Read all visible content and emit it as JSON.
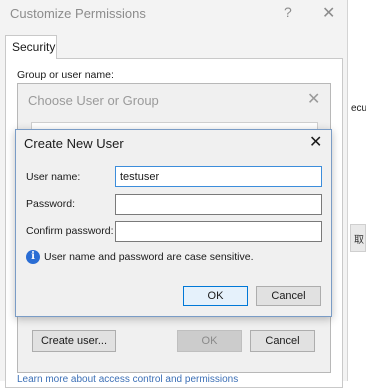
{
  "permissions_window": {
    "title": "Customize Permissions",
    "help_glyph": "?",
    "close_glyph": "✕",
    "tab_label": "Security",
    "group_label": "Group or user name:"
  },
  "behind_window": {
    "fragment_text": "ecu",
    "button_fragment": "取"
  },
  "choose_dialog": {
    "title": "Choose User or Group",
    "close_glyph": "✕",
    "create_user_label": "Create user...",
    "ok_label": "OK",
    "cancel_label": "Cancel",
    "bottom_link": "Learn more about access control and permissions"
  },
  "create_dialog": {
    "title": "Create New User",
    "close_glyph": "✕",
    "username_label": "User name:",
    "username_value": "testuser",
    "password_label": "Password:",
    "password_value": "",
    "confirm_label": "Confirm password:",
    "confirm_value": "",
    "info_glyph": "i",
    "info_text": "User name and password are case sensitive.",
    "ok_label": "OK",
    "cancel_label": "Cancel"
  },
  "colors": {
    "accent": "#0078d7",
    "info": "#2a6dd4",
    "link": "#3b6fb6"
  },
  "icons": [
    "close-icon",
    "help-icon",
    "info-icon"
  ]
}
